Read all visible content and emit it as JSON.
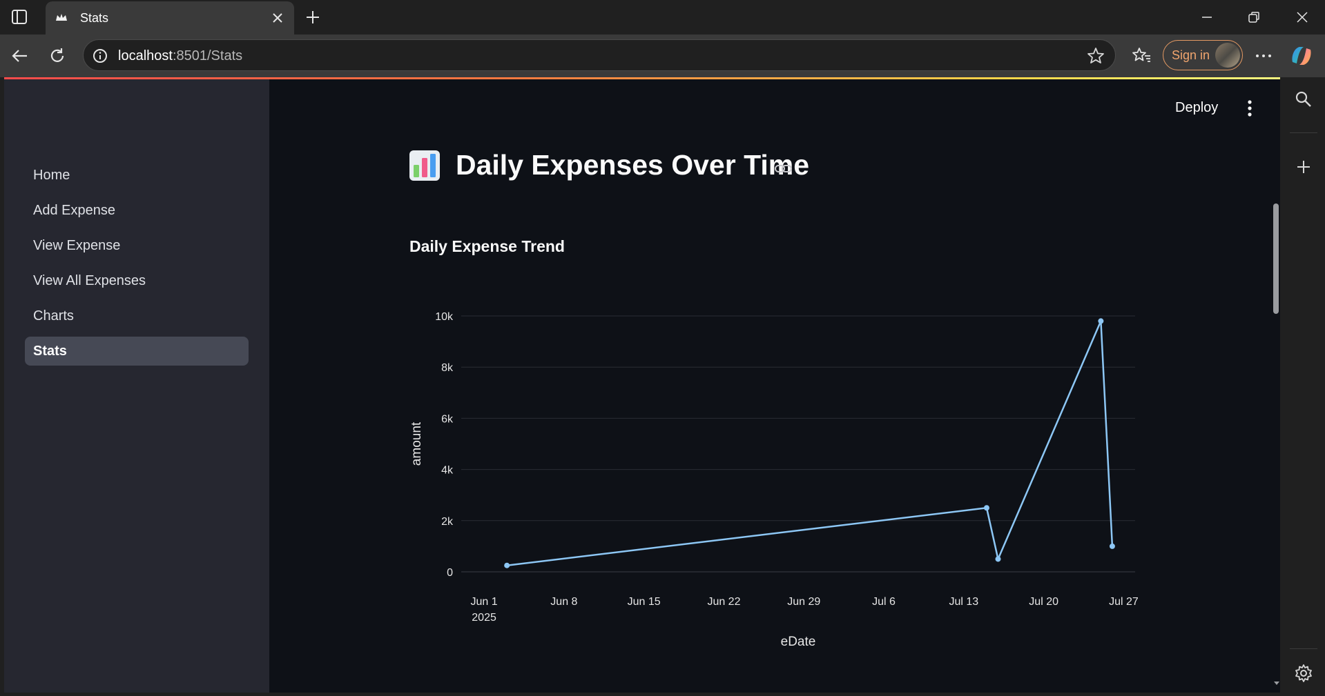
{
  "browser": {
    "tab_title": "Stats",
    "url_host": "localhost",
    "url_rest": ":8501/Stats",
    "sign_in_label": "Sign in"
  },
  "sidebar": {
    "items": [
      {
        "label": "Home",
        "active": false
      },
      {
        "label": "Add Expense",
        "active": false
      },
      {
        "label": "View Expense",
        "active": false
      },
      {
        "label": "View All Expenses",
        "active": false
      },
      {
        "label": "Charts",
        "active": false
      },
      {
        "label": "Stats",
        "active": true
      }
    ]
  },
  "header": {
    "deploy_label": "Deploy"
  },
  "main": {
    "title": "Daily Expenses Over Time",
    "title_icon": "bar-chart-emoji",
    "chart_heading": "Daily Expense Trend"
  },
  "colors": {
    "accent_line": "#8dc7f5",
    "page_bg": "#0e1117",
    "sidebar_bg": "#262730",
    "signin_border": "#e59a63"
  },
  "chart_data": {
    "type": "line",
    "xlabel": "eDate",
    "ylabel": "amount",
    "x_ticks": [
      "Jun 1",
      "Jun 8",
      "Jun 15",
      "Jun 22",
      "Jun 29",
      "Jul 6",
      "Jul 13",
      "Jul 20",
      "Jul 27"
    ],
    "x_year_label": "2025",
    "y_ticks": [
      "0",
      "2k",
      "4k",
      "6k",
      "8k",
      "10k"
    ],
    "ylim": [
      0,
      10000
    ],
    "x_range": [
      "2025-05-30",
      "2025-07-28"
    ],
    "grid": true,
    "series": [
      {
        "points": [
          {
            "x": "2025-06-03",
            "y": 250
          },
          {
            "x": "2025-07-15",
            "y": 2500
          },
          {
            "x": "2025-07-16",
            "y": 500
          },
          {
            "x": "2025-07-25",
            "y": 9800
          },
          {
            "x": "2025-07-26",
            "y": 1000
          }
        ]
      }
    ]
  }
}
